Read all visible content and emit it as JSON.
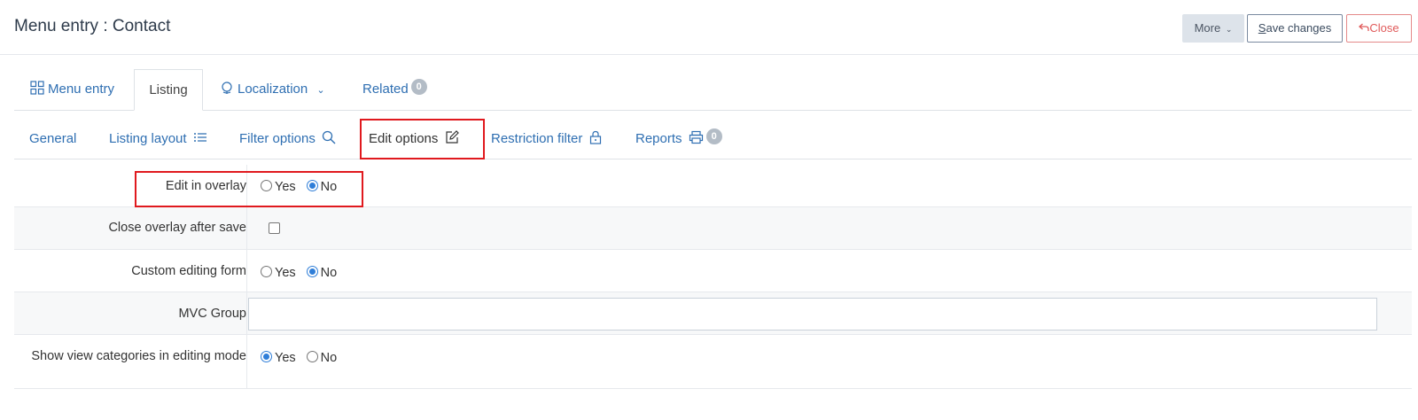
{
  "header": {
    "title": "Menu entry : Contact",
    "more_label": "More",
    "save_label_first": "S",
    "save_label_rest": "ave changes",
    "close_label": "Close"
  },
  "tabs": [
    {
      "label": "Menu entry",
      "icon": "grid-icon"
    },
    {
      "label": "Listing",
      "active": true
    },
    {
      "label": "Localization",
      "icon": "globe-icon"
    },
    {
      "label": "Related",
      "badge": "0"
    }
  ],
  "subtabs": [
    {
      "label": "General"
    },
    {
      "label": "Listing layout",
      "icon": "list-icon"
    },
    {
      "label": "Filter options",
      "icon": "search-icon"
    },
    {
      "label": "Edit options",
      "icon": "edit-icon",
      "active": true
    },
    {
      "label": "Restriction filter",
      "icon": "lock-icon"
    },
    {
      "label": "Reports",
      "icon": "printer-icon",
      "badge": "0"
    }
  ],
  "form": {
    "yes_label": "Yes",
    "no_label": "No",
    "rows": [
      {
        "label": "Edit in overlay",
        "type": "radio",
        "value": "No"
      },
      {
        "label": "Close overlay after save",
        "type": "checkbox",
        "checked": false
      },
      {
        "label": "Custom editing form",
        "type": "radio",
        "value": "No"
      },
      {
        "label": "MVC Group",
        "type": "text",
        "value": ""
      },
      {
        "label": "Show view categories in editing mode",
        "type": "radio",
        "value": "Yes"
      }
    ]
  },
  "colors": {
    "link": "#2f6fb2",
    "highlight": "#e0191e",
    "radio_checked": "#2f7ed8",
    "close_button": "#e05a5a"
  }
}
